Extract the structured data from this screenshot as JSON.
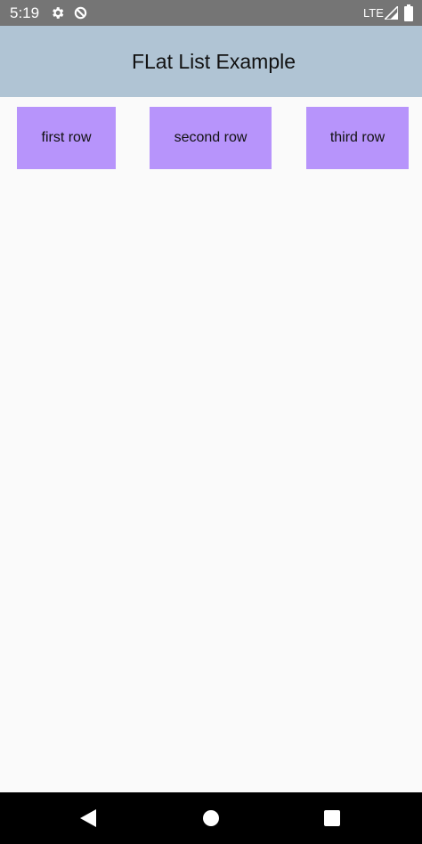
{
  "status_bar": {
    "time": "5:19",
    "network": "LTE",
    "icons": [
      "gear-icon",
      "data-saver-icon",
      "signal-icon",
      "battery-icon"
    ]
  },
  "header": {
    "title": "FLat List Example"
  },
  "list": {
    "items": [
      {
        "label": "first row"
      },
      {
        "label": "second row"
      },
      {
        "label": "third row"
      }
    ]
  },
  "nav_bar": {
    "icons": [
      "back-icon",
      "home-icon",
      "recents-icon"
    ]
  },
  "colors": {
    "status_bar": "#757575",
    "header": "#b0c4d4",
    "row": "#b794fb",
    "background": "#fafafa",
    "nav_bar": "#000000"
  }
}
